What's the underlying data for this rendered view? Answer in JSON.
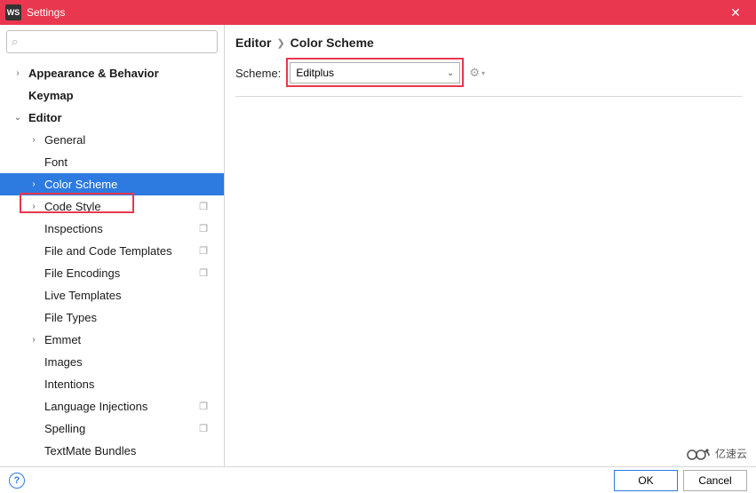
{
  "title": "Settings",
  "app_badge": "WS",
  "breadcrumb": {
    "a": "Editor",
    "b": "Color Scheme"
  },
  "scheme": {
    "label": "Scheme:",
    "value": "Editplus"
  },
  "sidebar": {
    "items": [
      {
        "label": "Appearance & Behavior",
        "bold": true,
        "chev": ">",
        "ind": 0
      },
      {
        "label": "Keymap",
        "bold": true,
        "chev": "",
        "ind": 0
      },
      {
        "label": "Editor",
        "bold": true,
        "chev": "v",
        "ind": 0
      },
      {
        "label": "General",
        "chev": ">",
        "ind": 1
      },
      {
        "label": "Font",
        "chev": "",
        "ind": 1
      },
      {
        "label": "Color Scheme",
        "chev": ">",
        "ind": 1,
        "sel": true
      },
      {
        "label": "Code Style",
        "chev": ">",
        "ind": 1,
        "copy": true
      },
      {
        "label": "Inspections",
        "chev": "",
        "ind": 1,
        "copy": true
      },
      {
        "label": "File and Code Templates",
        "chev": "",
        "ind": 1,
        "copy": true
      },
      {
        "label": "File Encodings",
        "chev": "",
        "ind": 1,
        "copy": true
      },
      {
        "label": "Live Templates",
        "chev": "",
        "ind": 1
      },
      {
        "label": "File Types",
        "chev": "",
        "ind": 1
      },
      {
        "label": "Emmet",
        "chev": ">",
        "ind": 1
      },
      {
        "label": "Images",
        "chev": "",
        "ind": 1
      },
      {
        "label": "Intentions",
        "chev": "",
        "ind": 1
      },
      {
        "label": "Language Injections",
        "chev": "",
        "ind": 1,
        "copy": true
      },
      {
        "label": "Spelling",
        "chev": "",
        "ind": 1,
        "copy": true
      },
      {
        "label": "TextMate Bundles",
        "chev": "",
        "ind": 1
      }
    ]
  },
  "buttons": {
    "ok": "OK",
    "cancel": "Cancel"
  },
  "watermark_text": "亿速云"
}
